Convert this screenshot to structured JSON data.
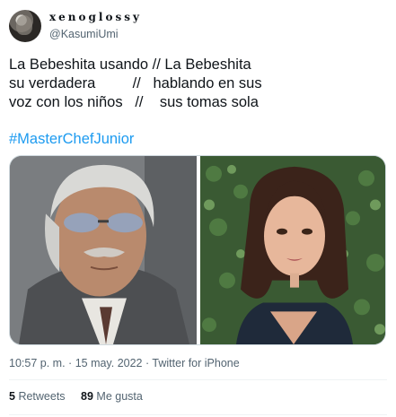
{
  "author": {
    "display_name": "xenoglossy",
    "handle": "@KasumiUmi",
    "avatar_icon": "avatar-portrait"
  },
  "tweet": {
    "lines": [
      "La Bebeshita usando // La Bebeshita",
      "su verdadera         //   hablando en sus",
      "voz con los niños   //    sus tomas sola"
    ],
    "hashtag": "#MasterChefJunior"
  },
  "media": {
    "left_photo": "older man with grey hair, tinted glasses and mustache",
    "right_photo": "young woman with half-up hair in front of green ivy"
  },
  "meta": {
    "time": "10:57 p. m.",
    "separator": "·",
    "date": "15 may. 2022",
    "source": "Twitter for iPhone"
  },
  "stats": {
    "retweets_count": "5",
    "retweets_label": "Retweets",
    "likes_count": "89",
    "likes_label": "Me gusta"
  },
  "colors": {
    "link": "#1d9bf0",
    "secondary_text": "#536471",
    "primary_text": "#0f1419"
  }
}
